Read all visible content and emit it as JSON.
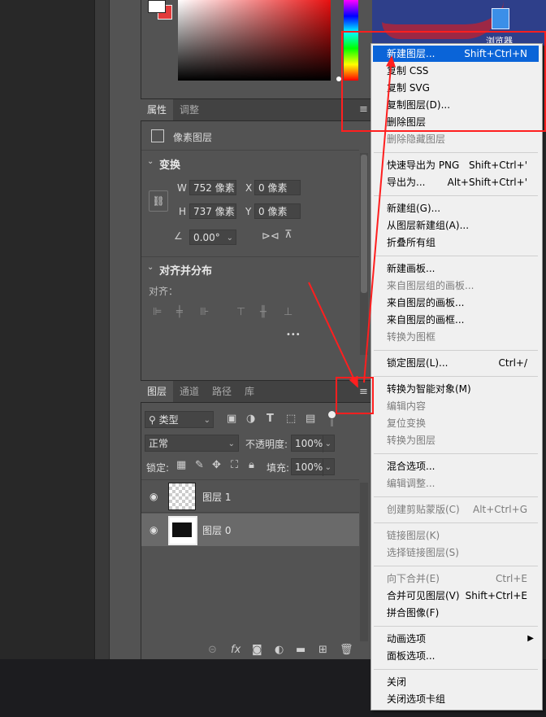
{
  "desktop": {
    "icon_label": "浏览器"
  },
  "properties_panel": {
    "tabs": [
      "属性",
      "调整"
    ],
    "layer_type": "像素图层",
    "transform": {
      "title": "变换",
      "w_label": "W",
      "w_value": "752 像素",
      "x_label": "X",
      "x_value": "0 像素",
      "h_label": "H",
      "h_value": "737 像素",
      "y_label": "Y",
      "y_value": "0 像素",
      "angle_value": "0.00°"
    },
    "align": {
      "title": "对齐并分布",
      "align_label": "对齐：",
      "more": "•••"
    }
  },
  "layers_panel": {
    "tabs": [
      "图层",
      "通道",
      "路径",
      "库"
    ],
    "filter_kind": "类型",
    "blend_mode": "正常",
    "opacity_label": "不透明度:",
    "opacity_value": "100%",
    "lock_label": "锁定:",
    "fill_label": "填充:",
    "fill_value": "100%",
    "layers": [
      {
        "name": "图层 1",
        "visible": true,
        "selected": false
      },
      {
        "name": "图层 0",
        "visible": true,
        "selected": true
      }
    ]
  },
  "context_menu": {
    "groups": [
      [
        {
          "label": "新建图层...",
          "shortcut": "Shift+Ctrl+N",
          "enabled": true,
          "highlighted": true
        },
        {
          "label": "复制 CSS",
          "shortcut": "",
          "enabled": true
        },
        {
          "label": "复制 SVG",
          "shortcut": "",
          "enabled": true
        },
        {
          "label": "复制图层(D)...",
          "shortcut": "",
          "enabled": true
        },
        {
          "label": "删除图层",
          "shortcut": "",
          "enabled": true
        },
        {
          "label": "删除隐藏图层",
          "shortcut": "",
          "enabled": false
        }
      ],
      [
        {
          "label": "快速导出为 PNG",
          "shortcut": "Shift+Ctrl+'",
          "enabled": true
        },
        {
          "label": "导出为...",
          "shortcut": "Alt+Shift+Ctrl+'",
          "enabled": true
        }
      ],
      [
        {
          "label": "新建组(G)...",
          "shortcut": "",
          "enabled": true
        },
        {
          "label": "从图层新建组(A)...",
          "shortcut": "",
          "enabled": true
        },
        {
          "label": "折叠所有组",
          "shortcut": "",
          "enabled": true
        }
      ],
      [
        {
          "label": "新建画板...",
          "shortcut": "",
          "enabled": true
        },
        {
          "label": "来自图层组的画板...",
          "shortcut": "",
          "enabled": false
        },
        {
          "label": "来自图层的画板...",
          "shortcut": "",
          "enabled": true
        },
        {
          "label": "来自图层的画框...",
          "shortcut": "",
          "enabled": true
        },
        {
          "label": "转换为图框",
          "shortcut": "",
          "enabled": false
        }
      ],
      [
        {
          "label": "锁定图层(L)...",
          "shortcut": "Ctrl+/",
          "enabled": true
        }
      ],
      [
        {
          "label": "转换为智能对象(M)",
          "shortcut": "",
          "enabled": true
        },
        {
          "label": "编辑内容",
          "shortcut": "",
          "enabled": false
        },
        {
          "label": "复位变换",
          "shortcut": "",
          "enabled": false
        },
        {
          "label": "转换为图层",
          "shortcut": "",
          "enabled": false
        }
      ],
      [
        {
          "label": "混合选项...",
          "shortcut": "",
          "enabled": true
        },
        {
          "label": "编辑调整...",
          "shortcut": "",
          "enabled": false
        }
      ],
      [
        {
          "label": "创建剪贴蒙版(C)",
          "shortcut": "Alt+Ctrl+G",
          "enabled": false
        }
      ],
      [
        {
          "label": "链接图层(K)",
          "shortcut": "",
          "enabled": false
        },
        {
          "label": "选择链接图层(S)",
          "shortcut": "",
          "enabled": false
        }
      ],
      [
        {
          "label": "向下合并(E)",
          "shortcut": "Ctrl+E",
          "enabled": false
        },
        {
          "label": "合并可见图层(V)",
          "shortcut": "Shift+Ctrl+E",
          "enabled": true
        },
        {
          "label": "拼合图像(F)",
          "shortcut": "",
          "enabled": true
        }
      ],
      [
        {
          "label": "动画选项",
          "shortcut": "",
          "enabled": true,
          "submenu": true
        },
        {
          "label": "面板选项...",
          "shortcut": "",
          "enabled": true
        }
      ],
      [
        {
          "label": "关闭",
          "shortcut": "",
          "enabled": true
        },
        {
          "label": "关闭选项卡组",
          "shortcut": "",
          "enabled": true
        }
      ]
    ]
  },
  "colors": {
    "highlight": "#0a64d8",
    "annotation_red": "#ff1f1f",
    "panel": "#535353"
  }
}
